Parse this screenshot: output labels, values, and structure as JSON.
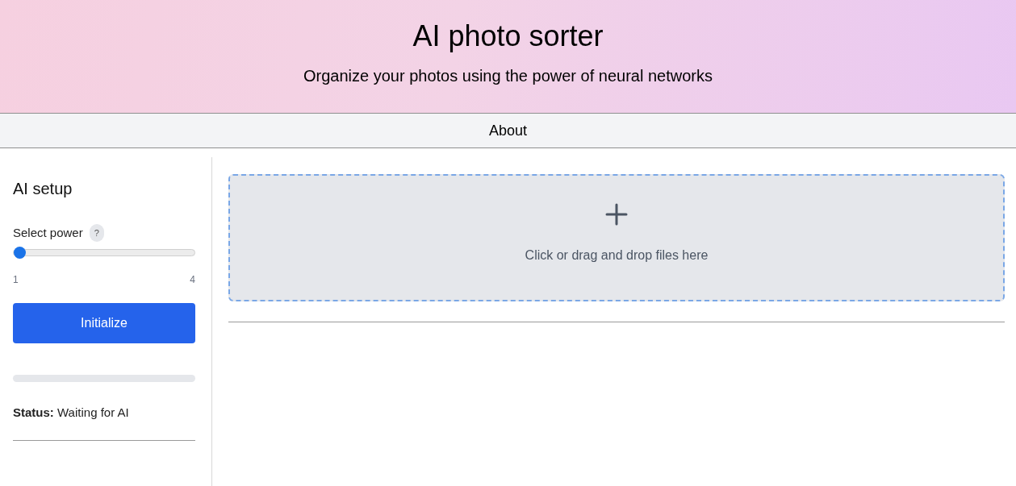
{
  "header": {
    "title": "AI photo sorter",
    "subtitle": "Organize your photos using the power of neural networks"
  },
  "nav": {
    "links": [
      {
        "label": "About"
      }
    ]
  },
  "setup": {
    "heading": "AI setup",
    "power": {
      "label": "Select power",
      "help": "?",
      "level": 0,
      "min_label": "1",
      "max_label": "4"
    },
    "button": "Initialize",
    "progress": {
      "level": 0
    },
    "status": "**Status:** Waiting for AI"
  },
  "dropzone": {
    "text": "Click or drag and drop files here"
  }
}
